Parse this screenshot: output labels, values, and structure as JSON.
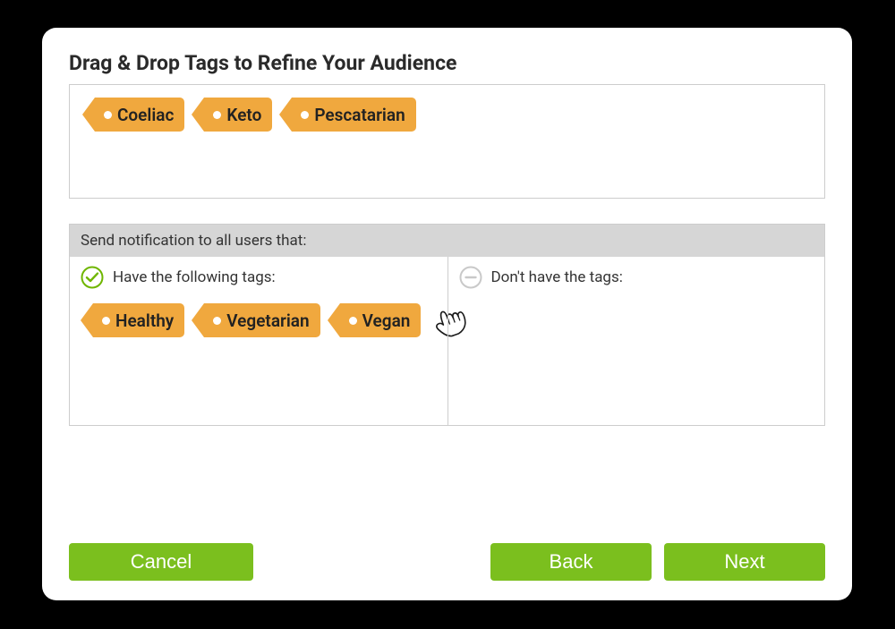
{
  "title": "Drag & Drop Tags to Refine Your Audience",
  "source_tags": [
    {
      "label": "Coeliac"
    },
    {
      "label": "Keto"
    },
    {
      "label": "Pescatarian"
    }
  ],
  "rules": {
    "header": "Send notification to all users that:",
    "have": {
      "label": "Have the following tags:",
      "tags": [
        {
          "label": "Healthy"
        },
        {
          "label": "Vegetarian"
        },
        {
          "label": "Vegan"
        }
      ]
    },
    "dont_have": {
      "label": "Don't have the tags:",
      "tags": []
    }
  },
  "footer": {
    "cancel": "Cancel",
    "back": "Back",
    "next": "Next"
  }
}
